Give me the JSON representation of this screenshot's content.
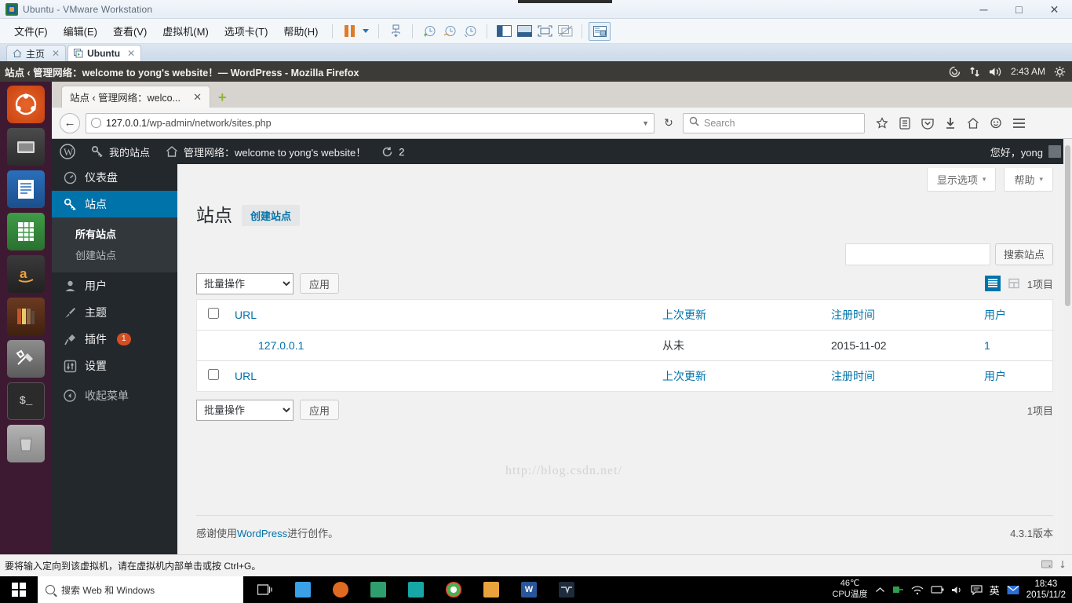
{
  "vmware": {
    "window_title": "Ubuntu - VMware Workstation",
    "icon": "vmware-icon",
    "window_buttons": {
      "minimize": "─",
      "maximize": "□",
      "close": "✕"
    },
    "menus": [
      "文件(F)",
      "编辑(E)",
      "查看(V)",
      "虚拟机(M)",
      "选项卡(T)",
      "帮助(H)"
    ],
    "tabs": [
      {
        "label": "主页",
        "icon": "home-icon",
        "active": false
      },
      {
        "label": "Ubuntu",
        "icon": "vm-icon",
        "active": true
      }
    ],
    "status_hint": "要将输入定向到该虚拟机，请在虚拟机内部单击或按 Ctrl+G。"
  },
  "ubuntu": {
    "panel_title": "站点 ‹ 管理网络：welcome to yong's website！— WordPress - Mozilla Firefox",
    "clock": "2:43 AM",
    "indicators": [
      "sync-icon",
      "network-icon",
      "volume-icon",
      "gear-icon"
    ],
    "launcher": [
      {
        "name": "ubuntu-dash-icon",
        "glyph": ""
      },
      {
        "name": "files-icon",
        "glyph": ""
      },
      {
        "name": "libreoffice-writer-icon",
        "glyph": ""
      },
      {
        "name": "libreoffice-calc-icon",
        "glyph": ""
      },
      {
        "name": "amazon-icon",
        "glyph": "a"
      },
      {
        "name": "ubuntu-software-icon",
        "glyph": ""
      },
      {
        "name": "system-settings-icon",
        "glyph": ""
      },
      {
        "name": "terminal-icon",
        "glyph": "$_"
      },
      {
        "name": "trash-icon",
        "glyph": ""
      }
    ]
  },
  "firefox": {
    "tab": {
      "title": "站点 ‹ 管理网络：welco...",
      "close": "✕"
    },
    "new_tab": "+",
    "url": {
      "host": "127.0.0.1",
      "path": "/wp-admin/network/sites.php"
    },
    "search_placeholder": "Search",
    "toolbar_icons": [
      "bookmark-star-icon",
      "reader-list-icon",
      "pocket-icon",
      "downloads-icon",
      "home-icon",
      "sync-account-icon",
      "hamburger-menu-icon"
    ]
  },
  "wordpress": {
    "adminbar": {
      "logo": "wordpress-logo-icon",
      "my_sites": {
        "label": "我的站点",
        "icon": "key-icon"
      },
      "network": {
        "label": "管理网络：welcome to yong's website！",
        "icon": "home-icon"
      },
      "updates": {
        "icon": "updates-icon",
        "count": "2"
      },
      "greeting": "您好，yong"
    },
    "menu": [
      {
        "label": "仪表盘",
        "icon": "dashboard-icon",
        "active": false
      },
      {
        "label": "站点",
        "icon": "key-icon",
        "active": true
      },
      {
        "label": "用户",
        "icon": "user-icon",
        "active": false
      },
      {
        "label": "主题",
        "icon": "appearance-icon",
        "active": false
      },
      {
        "label": "插件",
        "icon": "plugins-icon",
        "active": false,
        "badge": "1"
      },
      {
        "label": "设置",
        "icon": "settings-icon",
        "active": false
      }
    ],
    "submenu": [
      {
        "label": "所有站点",
        "current": true
      },
      {
        "label": "创建站点",
        "current": false
      }
    ],
    "collapse": {
      "label": "收起菜单",
      "icon": "collapse-icon"
    },
    "screen_meta": [
      {
        "label": "显示选项",
        "caret": "▾"
      },
      {
        "label": "帮助",
        "caret": "▾"
      }
    ],
    "page": {
      "title": "站点",
      "action_label": "创建站点",
      "search": {
        "value": "",
        "button": "搜索站点"
      },
      "bulk": {
        "selected": "批量操作",
        "apply": "应用"
      },
      "view_modes": [
        "list-view-icon",
        "excerpt-view-icon"
      ],
      "item_count": "1项目",
      "columns": [
        "URL",
        "上次更新",
        "注册时间",
        "用户"
      ],
      "rows": [
        {
          "url": "127.0.0.1",
          "last_updated": "从未",
          "registered": "2015-11-02",
          "users": "1"
        }
      ],
      "watermark": "http://blog.csdn.net/"
    },
    "footer": {
      "thanks_pre": "感谢使用",
      "thanks_link": "WordPress",
      "thanks_post": "进行创作。",
      "version": "4.3.1版本"
    }
  },
  "windows": {
    "start": "start-button",
    "search_placeholder": "搜索 Web 和 Windows",
    "taskbar_icons": [
      "task-view-icon",
      "explorer-icon",
      "app-orange-icon",
      "app-green-icon",
      "app-teal-icon",
      "chrome-icon",
      "folder-icon",
      "word-icon",
      "vmware-icon"
    ],
    "tray": {
      "cpu_temp": "46℃",
      "cpu_label": "CPU温度",
      "icons": [
        "chevron-up-icon",
        "usb-icon",
        "wifi-icon",
        "battery-icon",
        "volume-icon",
        "notification-icon",
        "ime-icon",
        "mail-icon"
      ],
      "ime": "英",
      "time": "18:43",
      "date": "2015/11/2"
    }
  }
}
